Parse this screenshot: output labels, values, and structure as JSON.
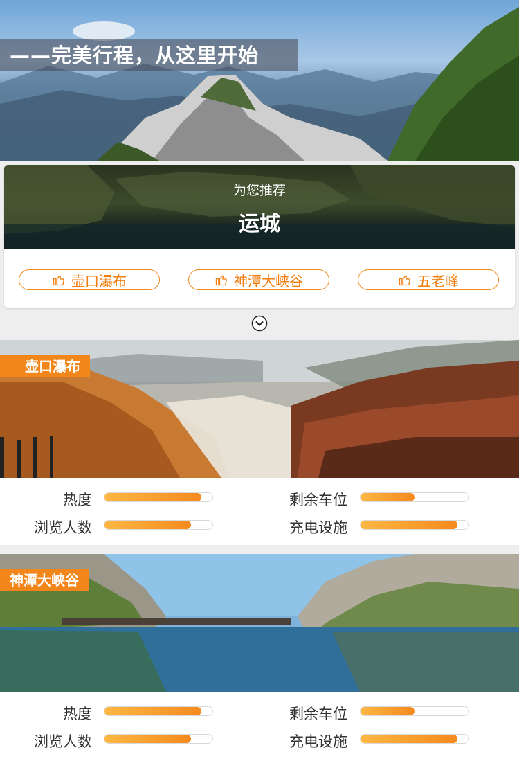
{
  "hero": {
    "banner": "——完美行程，从这里开始"
  },
  "recommend": {
    "subtitle": "为您推荐",
    "city": "运城",
    "buttons": [
      "壶口瀑布",
      "神潭大峡谷",
      "五老峰"
    ]
  },
  "spots": [
    {
      "name": "壶口瀑布",
      "metrics": [
        {
          "label": "热度",
          "value": 0.9
        },
        {
          "label": "剩余车位",
          "value": 0.5
        },
        {
          "label": "浏览人数",
          "value": 0.8
        },
        {
          "label": "充电设施",
          "value": 0.9
        }
      ]
    },
    {
      "name": "神潭大峡谷",
      "metrics": [
        {
          "label": "热度",
          "value": 0.9
        },
        {
          "label": "剩余车位",
          "value": 0.5
        },
        {
          "label": "浏览人数",
          "value": 0.8
        },
        {
          "label": "充电设施",
          "value": 0.9
        }
      ]
    }
  ],
  "colors": {
    "accent": "#f2861a",
    "bar_start": "#ffb743",
    "bar_end": "#f58a1f"
  }
}
